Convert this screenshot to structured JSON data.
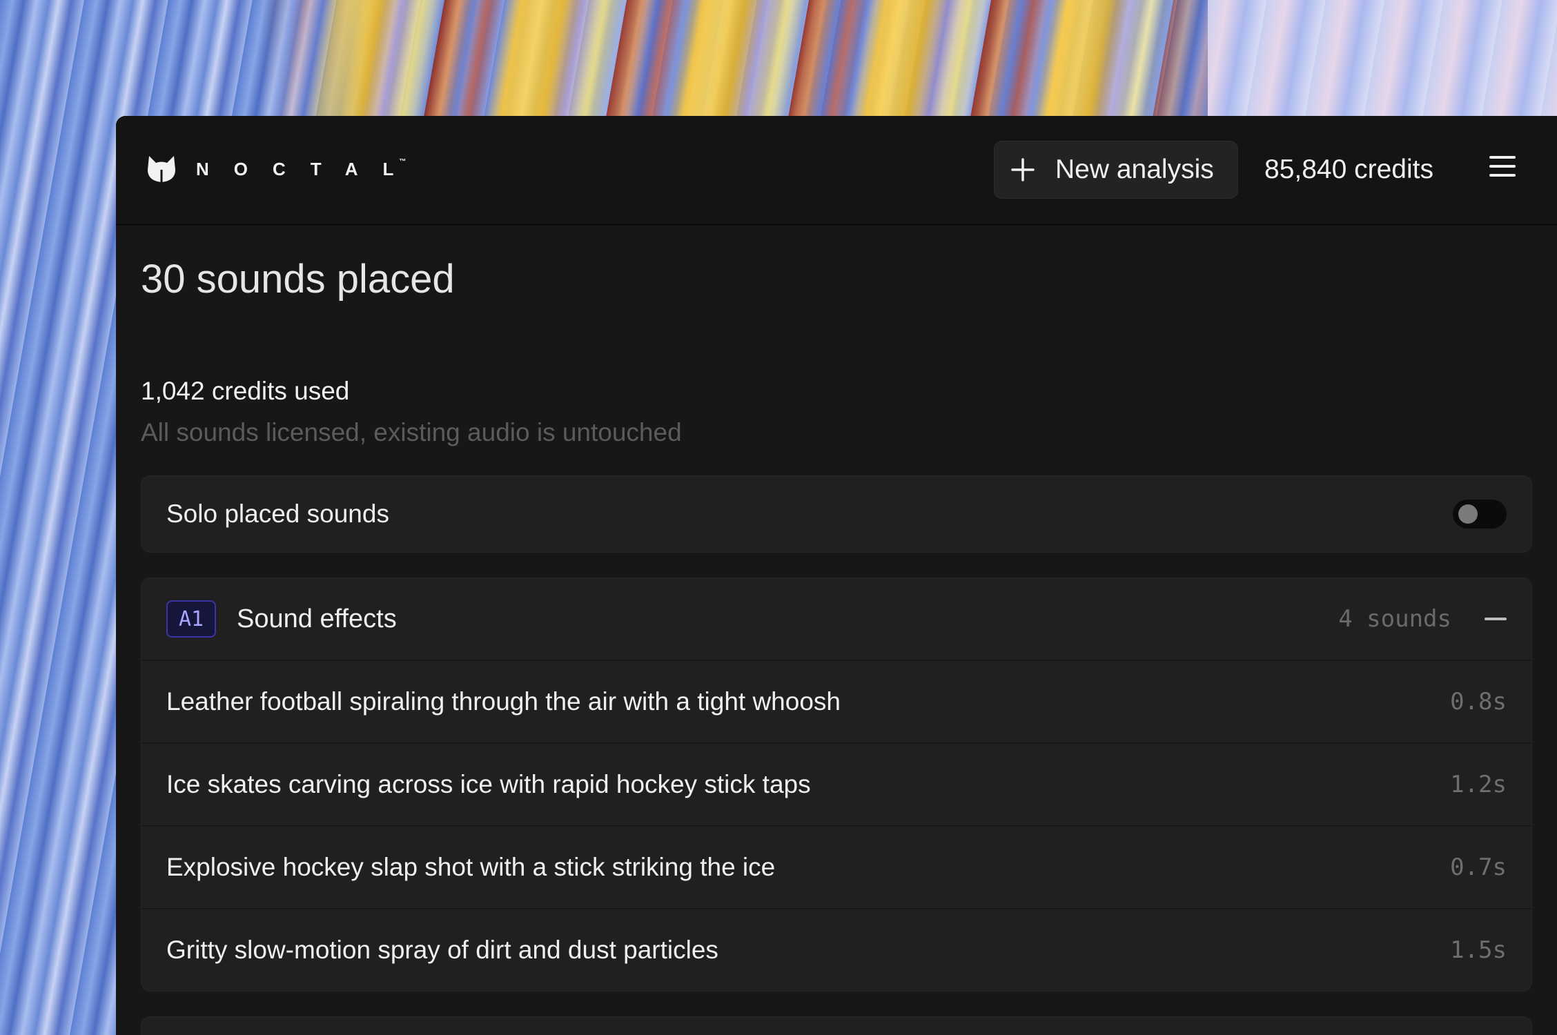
{
  "brand": {
    "name": "NOCTAL",
    "trademark": "™"
  },
  "header": {
    "new_analysis_label": "New analysis",
    "credits_label": "85,840 credits"
  },
  "summary": {
    "title": "30 sounds placed",
    "credits_used": "1,042 credits used",
    "note": "All sounds licensed, existing audio is untouched"
  },
  "solo": {
    "label": "Solo placed sounds",
    "enabled": false
  },
  "groups": [
    {
      "badge": "A1",
      "title": "Sound effects",
      "count_label": "4 sounds",
      "expanded": true,
      "items": [
        {
          "label": "Leather football spiraling through the air with a tight whoosh",
          "duration": "0.8s"
        },
        {
          "label": "Ice skates carving across ice with rapid hockey stick taps",
          "duration": "1.2s"
        },
        {
          "label": "Explosive hockey slap shot with a stick striking the ice",
          "duration": "0.7s"
        },
        {
          "label": "Gritty slow-motion spray of dirt and dust particles",
          "duration": "1.5s"
        }
      ]
    }
  ],
  "icons": {
    "logo": "cat-head-icon",
    "new_analysis": "plus-icon",
    "menu": "hamburger-menu-icon",
    "collapse": "minus-icon"
  },
  "colors": {
    "app_bg": "#171717",
    "card_bg": "#202020",
    "badge_border": "#3a34a8",
    "badge_text": "#a8a4ff",
    "muted_text": "#5b5b5b"
  }
}
